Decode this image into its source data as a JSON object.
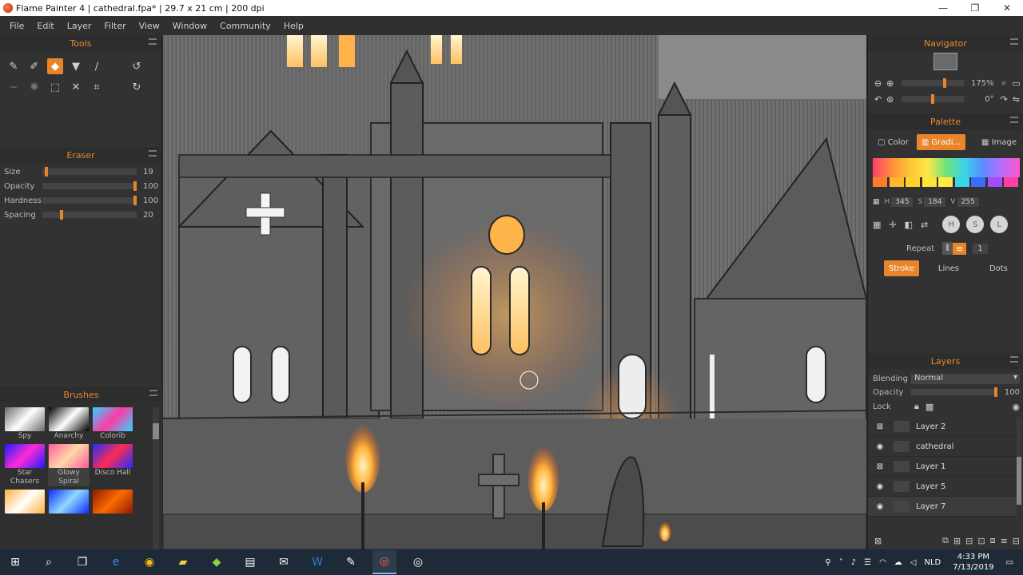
{
  "window": {
    "title": "Flame Painter 4 | cathedral.fpa* | 29.7 x 21 cm | 200 dpi",
    "controls": [
      "—",
      "❐",
      "✕"
    ]
  },
  "menu": [
    "File",
    "Edit",
    "Layer",
    "Filter",
    "View",
    "Window",
    "Community",
    "Help"
  ],
  "tools_panel": {
    "title": "Tools"
  },
  "eraser_panel": {
    "title": "Eraser",
    "sliders": [
      {
        "label": "Size",
        "value": "19",
        "level": 0.04
      },
      {
        "label": "Opacity",
        "value": "100",
        "level": 1.0
      },
      {
        "label": "Hardness",
        "value": "100",
        "level": 1.0
      },
      {
        "label": "Spacing",
        "value": "20",
        "level": 0.2
      }
    ]
  },
  "brushes_panel": {
    "title": "Brushes",
    "items": [
      {
        "name": "Spy",
        "colors": [
          "#ffffff",
          "#6a6a6a"
        ]
      },
      {
        "name": "Anarchy",
        "colors": [
          "#ffffff",
          "#000000"
        ]
      },
      {
        "name": "Colorib",
        "colors": [
          "#ff3ba8",
          "#2ad7ff"
        ]
      },
      {
        "name": "Star Chasers",
        "colors": [
          "#ff2bd6",
          "#1b1bff"
        ]
      },
      {
        "name": "Glowy Spiral",
        "colors": [
          "#ffd9a8",
          "#ff5a9c"
        ]
      },
      {
        "name": "Disco Hall",
        "colors": [
          "#ff2a55",
          "#1e2dff"
        ]
      },
      {
        "name": "",
        "colors": [
          "#ffffff",
          "#ffb03a"
        ]
      },
      {
        "name": "",
        "colors": [
          "#8fd8ff",
          "#0a2aff"
        ]
      },
      {
        "name": "",
        "colors": [
          "#ff6a00",
          "#8a1a00"
        ]
      }
    ]
  },
  "navigator": {
    "title": "Navigator",
    "zoom": "175%",
    "zoom_level": 0.7,
    "rotation": "0°",
    "rotation_level": 0.5
  },
  "palette": {
    "title": "Palette",
    "tabs": [
      "Color",
      "Gradi...",
      "Image"
    ],
    "active_tab": 1,
    "swatches": [
      "#ff7a2a",
      "#ffb82a",
      "#ffd12a",
      "#ffe23a",
      "#ffea46",
      "#38d6e6",
      "#3a6cff",
      "#a24bff",
      "#ff3fa4"
    ],
    "hsv": {
      "h_label": "H",
      "h": "345",
      "s_label": "S",
      "s": "184",
      "v_label": "V",
      "v": "255"
    },
    "mode_buttons": [
      "H",
      "S",
      "L"
    ],
    "repeat_label": "Repeat",
    "repeat_value": "1",
    "modes": [
      "Stroke",
      "Lines",
      "Dots"
    ],
    "active_mode": 0
  },
  "layers": {
    "title": "Layers",
    "blending_label": "Blending",
    "blending_value": "Normal",
    "opacity_label": "Opacity",
    "opacity_value": "100",
    "opacity_level": 1.0,
    "lock_label": "Lock",
    "items": [
      {
        "name": "Layer 2",
        "visible": false
      },
      {
        "name": "cathedral",
        "visible": true
      },
      {
        "name": "Layer 1",
        "visible": false
      },
      {
        "name": "Layer 5",
        "visible": true
      },
      {
        "name": "Layer 7",
        "visible": true
      }
    ],
    "selected": 4
  },
  "taskbar": {
    "time": "4:33 PM",
    "date": "7/13/2019",
    "lang": "NLD"
  },
  "colors": {
    "accent": "#e8842a",
    "panel": "#323232",
    "canvas_bg": "#6c6c6c"
  }
}
